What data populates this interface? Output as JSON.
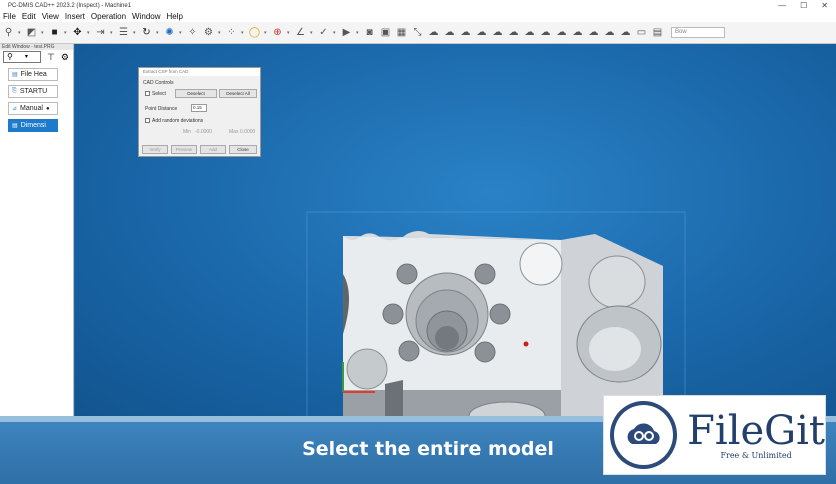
{
  "window": {
    "title": "PC-DMIS CAD++ 2023.2 (Inspect) - Machine1"
  },
  "menu": [
    "File",
    "Edit",
    "View",
    "Insert",
    "Operation",
    "Window",
    "Help"
  ],
  "toolbar": {
    "icons": [
      "probe-icon",
      "cube-perspective-icon",
      "cube-solid-icon",
      "move-icon",
      "translate-icon",
      "rotate-icon",
      "sphere-icon",
      "wand-icon",
      "fixture-icon",
      "dots-icon",
      "circle-select-icon",
      "crosshair-icon",
      "angle-icon",
      "check-icon",
      "play-icon",
      "camera-icon",
      "screenshot-icon",
      "grid-icon",
      "expand-icon",
      "cloud-1-icon",
      "cloud-2-icon",
      "cloud-3-icon",
      "cloud-4-icon",
      "cloud-5-icon",
      "cloud-6-icon",
      "cloud-7-icon",
      "cloud-8-icon",
      "cloud-9-icon",
      "cloud-10-icon",
      "cloud-11-icon",
      "cloud-12-icon",
      "cloud-13-icon",
      "image-icon",
      "table-icon"
    ],
    "selector_placeholder": "Bow"
  },
  "sidebar": {
    "title": "Edit Window - test.PRG",
    "items": [
      {
        "label": "File Hea",
        "active": false
      },
      {
        "label": "STARTU",
        "active": false
      },
      {
        "label": "Manual",
        "active": false
      },
      {
        "label": "Dimensi",
        "active": true
      }
    ]
  },
  "dialog": {
    "title": "Extract CSP from CAD",
    "section_label": "CAD Controls",
    "select_label": "Select",
    "deselect_label": "Deselect",
    "deselect_all_label": "Deselect All",
    "point_distance_label": "Point Distance",
    "point_distance_value": "0.15",
    "random_label": "Add random deviations",
    "min_label": "Min",
    "min_value": "-0.0000",
    "max_label": "Max",
    "max_value": "0.0000",
    "footer_buttons": [
      "Verify",
      "Preview",
      "Add",
      "Close"
    ]
  },
  "banner": {
    "caption": "Select the entire model"
  },
  "logo": {
    "name": "FileGit",
    "tagline": "Free & Unlimited"
  },
  "colors": {
    "viewport": "#1a67a9",
    "active_item": "#1f7acb",
    "banner": "#3577b1",
    "logo": "#23406c"
  }
}
